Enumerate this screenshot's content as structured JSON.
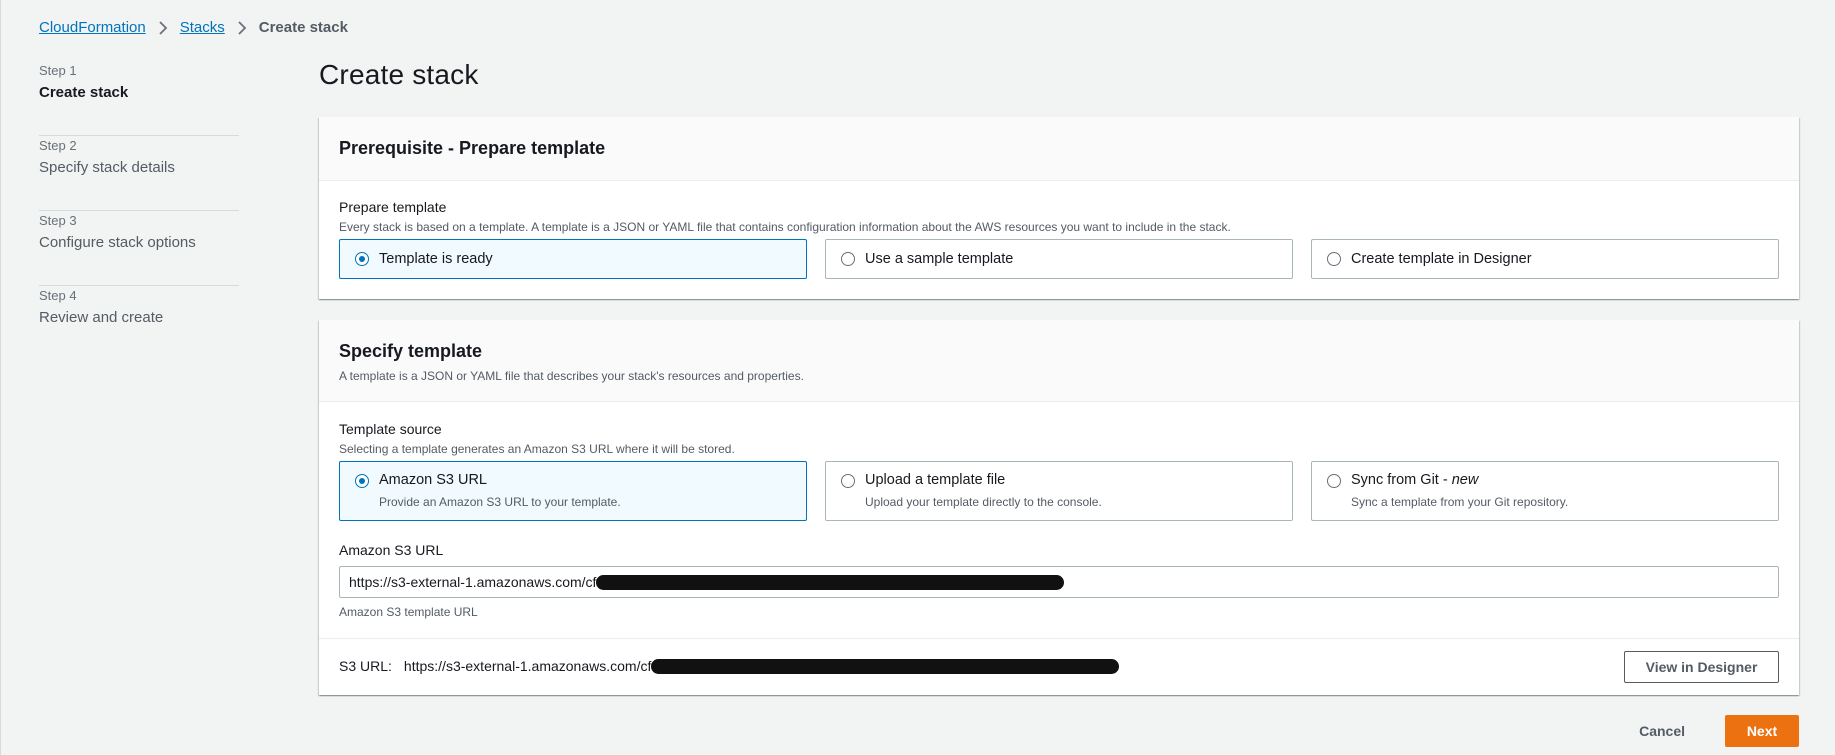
{
  "breadcrumb": {
    "items": [
      "CloudFormation",
      "Stacks"
    ],
    "current": "Create stack"
  },
  "steps": [
    {
      "num": "Step 1",
      "title": "Create stack",
      "active": true
    },
    {
      "num": "Step 2",
      "title": "Specify stack details",
      "active": false
    },
    {
      "num": "Step 3",
      "title": "Configure stack options",
      "active": false
    },
    {
      "num": "Step 4",
      "title": "Review and create",
      "active": false
    }
  ],
  "page_title": "Create stack",
  "prerequisite": {
    "heading": "Prerequisite - Prepare template",
    "field_label": "Prepare template",
    "field_desc": "Every stack is based on a template. A template is a JSON or YAML file that contains configuration information about the AWS resources you want to include in the stack.",
    "options": [
      {
        "label": "Template is ready",
        "selected": true
      },
      {
        "label": "Use a sample template",
        "selected": false
      },
      {
        "label": "Create template in Designer",
        "selected": false
      }
    ]
  },
  "specify": {
    "heading": "Specify template",
    "desc": "A template is a JSON or YAML file that describes your stack's resources and properties.",
    "source_label": "Template source",
    "source_desc": "Selecting a template generates an Amazon S3 URL where it will be stored.",
    "options": [
      {
        "label": "Amazon S3 URL",
        "suffix": "",
        "desc": "Provide an Amazon S3 URL to your template.",
        "selected": true
      },
      {
        "label": "Upload a template file",
        "suffix": "",
        "desc": "Upload your template directly to the console.",
        "selected": false
      },
      {
        "label": "Sync from Git - ",
        "suffix": "new",
        "desc": "Sync a template from your Git repository.",
        "selected": false
      }
    ],
    "url_label": "Amazon S3 URL",
    "url_value": "https://s3-external-1.amazonaws.com/cf",
    "url_hint": "Amazon S3 template URL",
    "s3_url_label": "S3 URL:",
    "s3_url_value": "https://s3-external-1.amazonaws.com/cf",
    "view_designer": "View in Designer"
  },
  "actions": {
    "cancel": "Cancel",
    "next": "Next"
  },
  "colors": {
    "accent": "#0073bb",
    "primary_button": "#ec7211",
    "background": "#f2f3f3"
  }
}
